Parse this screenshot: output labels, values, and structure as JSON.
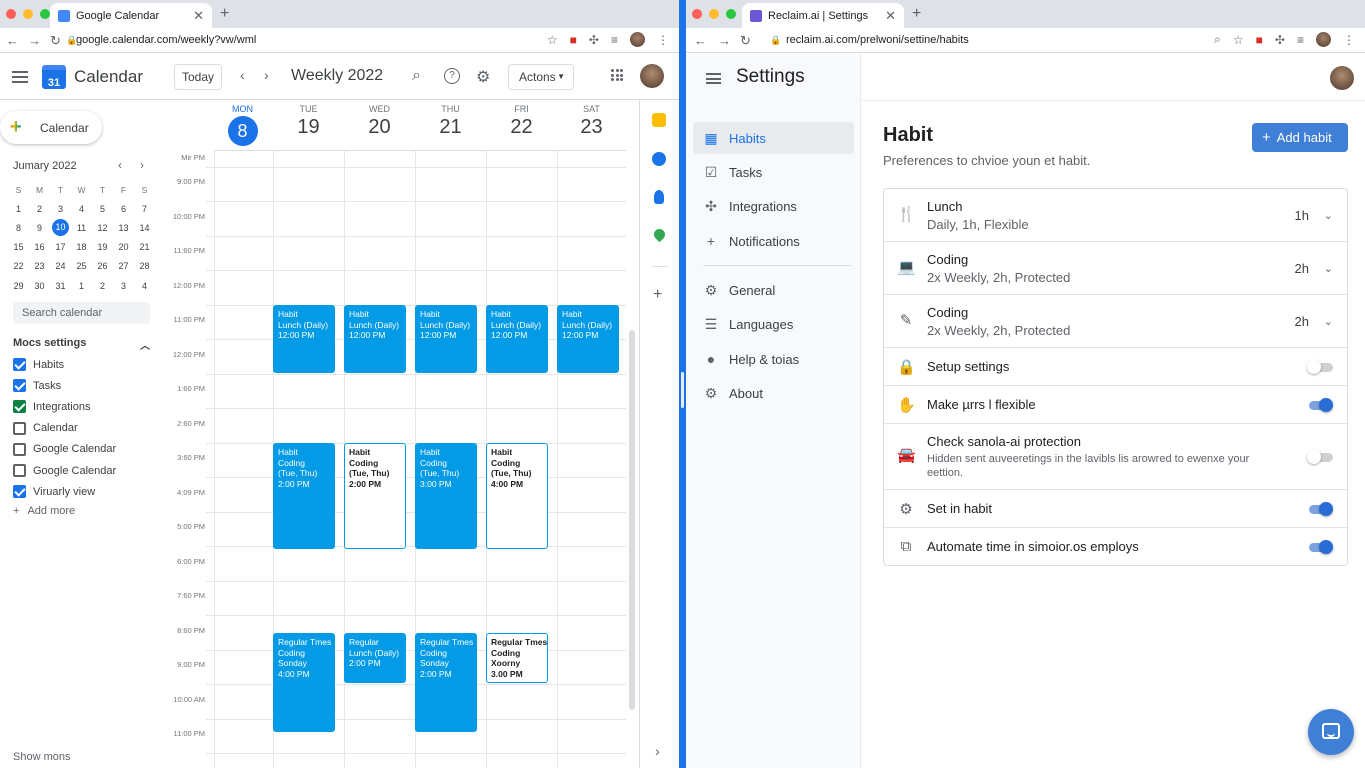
{
  "left_window": {
    "tab": {
      "title": "Google Calendar"
    },
    "url": "google.calendar.com/weekly?vw/wml",
    "app": {
      "title": "Calendar",
      "logo_text": "31"
    },
    "toolbar": {
      "today": "Today",
      "week_title": "Weekly 2022",
      "actions": "Actons"
    },
    "create_label": "Calendar",
    "mini_calendar": {
      "month": "Jumary 2022",
      "weekdays": [
        "S",
        "M",
        "T",
        "W",
        "T",
        "F",
        "S"
      ],
      "weeks": [
        [
          "1",
          "2",
          "3",
          "4",
          "5",
          "6",
          "7"
        ],
        [
          "8",
          "9",
          "10",
          "11",
          "12",
          "13",
          "14"
        ],
        [
          "15",
          "16",
          "17",
          "18",
          "19",
          "20",
          "21"
        ],
        [
          "22",
          "23",
          "24",
          "25",
          "26",
          "27",
          "28"
        ],
        [
          "29",
          "30",
          "31",
          "1",
          "2",
          "3",
          "4"
        ]
      ],
      "selected_day": "10"
    },
    "search_placeholder": "Search calendar",
    "my_calendars": {
      "heading": "Mocs settings",
      "items": [
        {
          "label": "Habits",
          "checked": true,
          "color": "#1a73e8"
        },
        {
          "label": "Tasks",
          "checked": true,
          "color": "#1a73e8"
        },
        {
          "label": "Integrations",
          "checked": true,
          "color": "#0b8043"
        },
        {
          "label": "Calendar",
          "checked": false,
          "color": "#5f6368"
        },
        {
          "label": "Google Calendar",
          "checked": false,
          "color": "#5f6368"
        },
        {
          "label": "Google Calendar",
          "checked": false,
          "color": "#5f6368"
        },
        {
          "label": "Viruarly view",
          "checked": true,
          "color": "#1a73e8"
        }
      ],
      "add_more": "Add more"
    },
    "show_more": "Show mons",
    "days": [
      {
        "name": "MON",
        "date": "8",
        "current": true
      },
      {
        "name": "TUE",
        "date": "19",
        "current": false
      },
      {
        "name": "WED",
        "date": "20",
        "current": false
      },
      {
        "name": "THU",
        "date": "21",
        "current": false
      },
      {
        "name": "FRI",
        "date": "22",
        "current": false
      },
      {
        "name": "SAT",
        "date": "23",
        "current": false
      }
    ],
    "time_labels": [
      "Mir PM",
      "9:00 PM",
      "10:00 PM",
      "11:60 PM",
      "12:00 PM",
      "11:00 PM",
      "12:00 PM",
      "1:60 PM",
      "2:60 PM",
      "3:60 PM",
      "4:09 PM",
      "5:00 PM",
      "6:00 PM",
      "7:60 PM",
      "8:60 PM",
      "9.00 PM",
      "10:00 AM",
      "11:00 PM"
    ],
    "events": [
      {
        "day": 0,
        "start": 3.55,
        "end": 5.5,
        "style": "solid",
        "lines": [
          "Habit",
          "Lunch (Daily)",
          "12:00 PM"
        ]
      },
      {
        "day": 1,
        "start": 3.55,
        "end": 5.5,
        "style": "solid",
        "lines": [
          "Habit",
          "Lunch (Daily)",
          "12:00 PM"
        ]
      },
      {
        "day": 2,
        "start": 3.55,
        "end": 5.5,
        "style": "solid",
        "lines": [
          "Habit",
          "Lunch (Daily)",
          "12:00 PM"
        ]
      },
      {
        "day": 3,
        "start": 3.55,
        "end": 5.5,
        "style": "solid",
        "lines": [
          "Habit",
          "Lunch (Daily)",
          "12:00 PM"
        ]
      },
      {
        "day": 4,
        "start": 3.55,
        "end": 5.5,
        "style": "solid",
        "lines": [
          "Habit",
          "Lunch (Daily)",
          "12:00 PM"
        ]
      },
      {
        "day": 0,
        "start": 7.55,
        "end": 10.6,
        "style": "solid",
        "lines": [
          "Habit",
          "Coding",
          "(Tue, Thu)",
          "2:00 PM"
        ]
      },
      {
        "day": 1,
        "start": 7.55,
        "end": 10.6,
        "style": "outline",
        "lines": [
          "Habit",
          "Coding",
          "(Tue, Thu)",
          "2:00 PM"
        ]
      },
      {
        "day": 2,
        "start": 7.55,
        "end": 10.6,
        "style": "solid",
        "lines": [
          "Habit",
          "Coding",
          "(Tue, Thu)",
          "3:00 PM"
        ]
      },
      {
        "day": 3,
        "start": 7.55,
        "end": 10.6,
        "style": "outline",
        "lines": [
          "Habit",
          "Coding",
          "(Tue, Thu)",
          "4:00 PM"
        ]
      },
      {
        "day": 0,
        "start": 13.05,
        "end": 15.9,
        "style": "solid",
        "lines": [
          "Regular Tmes",
          "Coding",
          "Sonday",
          "4:00 PM"
        ]
      },
      {
        "day": 1,
        "start": 13.05,
        "end": 14.5,
        "style": "solid",
        "lines": [
          "Regular",
          "Lunch (Daily)",
          "2:00 PM"
        ]
      },
      {
        "day": 2,
        "start": 13.05,
        "end": 15.9,
        "style": "solid",
        "lines": [
          "Regular Tmes",
          "Coding",
          "Sonday",
          "2:00 PM"
        ]
      },
      {
        "day": 3,
        "start": 13.05,
        "end": 14.5,
        "style": "outline",
        "lines": [
          "Regular Tmes",
          "Coding",
          "Xoorny",
          "3.00 PM"
        ]
      }
    ]
  },
  "right_window": {
    "tab": {
      "title": "Reclaim.ai | Settings"
    },
    "url": "reclaim.ai.com/prelwoni/settine/habits",
    "title": "Settings",
    "nav": [
      {
        "label": "Habits",
        "icon": "grid-icon",
        "glyph": "▦",
        "active": true
      },
      {
        "label": "Tasks",
        "icon": "checkbox-icon",
        "glyph": "☑",
        "active": false
      },
      {
        "label": "Integrations",
        "icon": "puzzle-icon",
        "glyph": "✣",
        "active": false
      },
      {
        "label": "Notifications",
        "icon": "plus-icon",
        "glyph": "+",
        "active": false
      },
      {
        "label": "General",
        "icon": "gear-icon",
        "glyph": "⚙",
        "active": false
      },
      {
        "label": "Languages",
        "icon": "list-icon",
        "glyph": "☰",
        "active": false
      },
      {
        "label": "Help & toias",
        "icon": "info-icon",
        "glyph": "●",
        "active": false
      },
      {
        "label": "About",
        "icon": "gear-icon",
        "glyph": "⚙",
        "active": false
      }
    ],
    "heading": "Habit",
    "subheading": "Preferences to chvioe youn et habit.",
    "add_button": "Add habit",
    "habits": [
      {
        "icon": "fork-knife-icon",
        "glyph": "🍴",
        "title": "Lunch",
        "subtitle": "Daily, 1h, Flexible",
        "duration": "1h"
      },
      {
        "icon": "laptop-icon",
        "glyph": "💻",
        "title": "Coding",
        "subtitle": "2x Weekly, 2h, Protected",
        "duration": "2h"
      },
      {
        "icon": "pencil-icon",
        "glyph": "✎",
        "title": "Coding",
        "subtitle": "2x Weekly, 2h, Protected",
        "duration": "2h"
      }
    ],
    "settings": [
      {
        "icon": "lock-icon",
        "glyph": "🔒",
        "title": "Setup settings",
        "description": "",
        "enabled": false
      },
      {
        "icon": "hand-icon",
        "glyph": "✋",
        "title": "Make µrrs l flexible",
        "description": "",
        "enabled": true
      },
      {
        "icon": "car-icon",
        "glyph": "🚘",
        "title": "Check sanola-ai protection",
        "description": "Hidden sent auveeretings in the lavibls lis arowred to ewenxe your eettion.",
        "enabled": false
      },
      {
        "icon": "gear-icon",
        "glyph": "⚙",
        "title": "Set in habit",
        "description": "",
        "enabled": true
      },
      {
        "icon": "external-link-icon",
        "glyph": "⧉",
        "title": "Automate time in simoior.os employs",
        "description": "",
        "enabled": true
      }
    ]
  }
}
